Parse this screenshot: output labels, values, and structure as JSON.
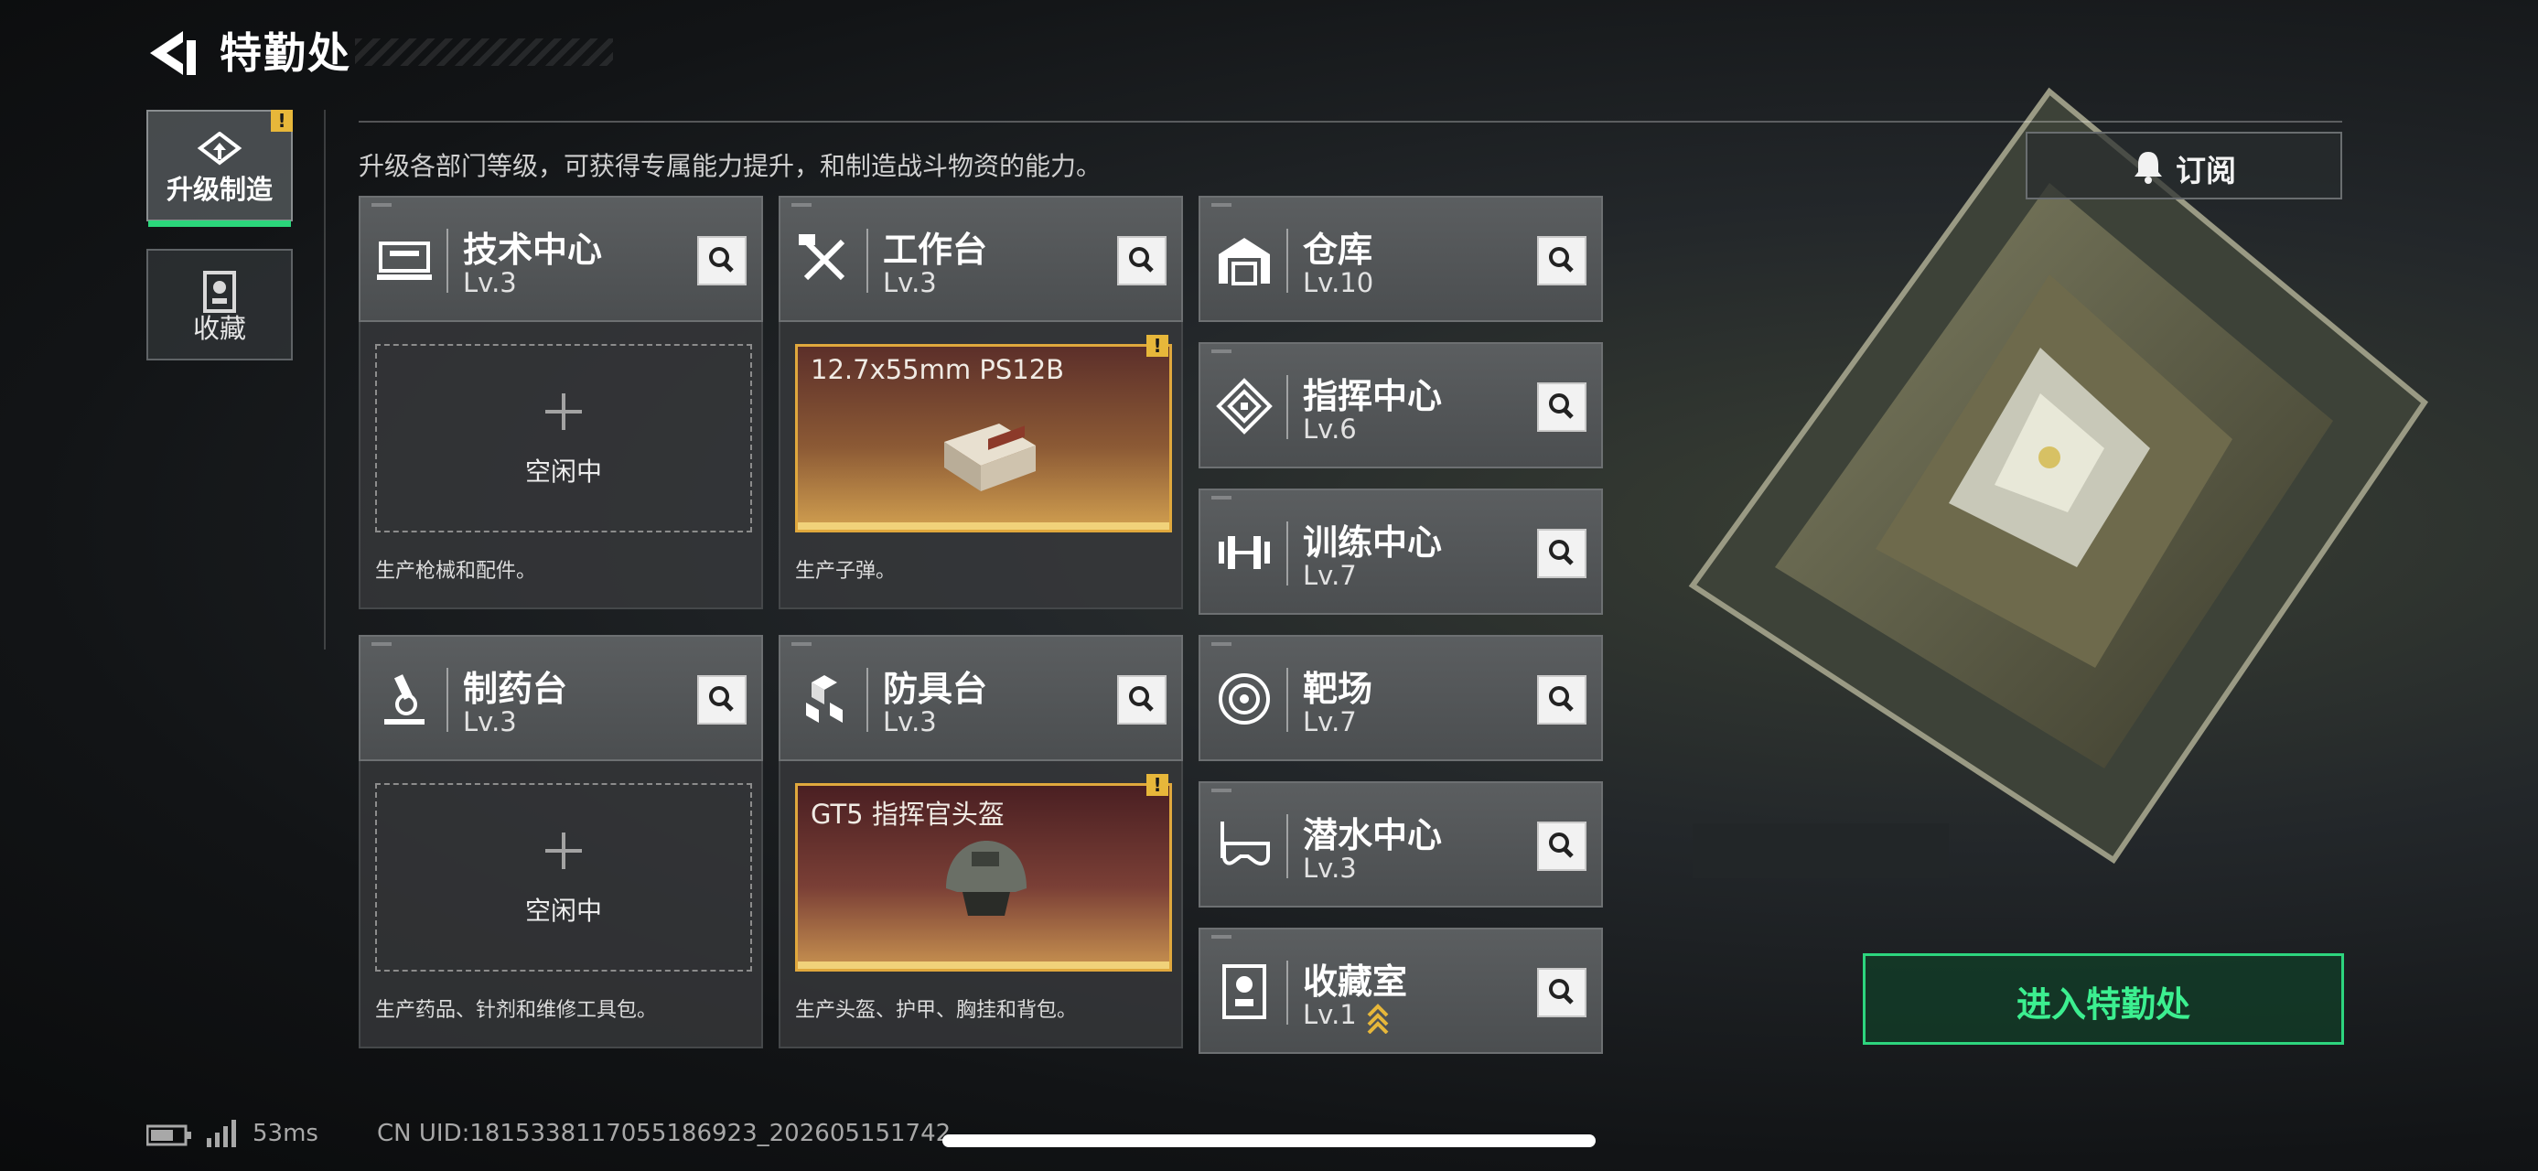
{
  "header": {
    "title": "特勤处"
  },
  "nav": {
    "tabs": [
      {
        "label": "升级制造",
        "active": true,
        "warning": "!"
      },
      {
        "label": "收藏",
        "active": false
      }
    ]
  },
  "subtitle": "升级各部门等级，可获得专属能力提升，和制造战斗物资的能力。",
  "subscribe": {
    "label": "订阅",
    "icon": "bell-icon"
  },
  "departments": {
    "tech_center": {
      "name": "技术中心",
      "level": "Lv.3",
      "icon": "tech-center-icon",
      "status": "空闲中",
      "desc": "生产枪械和配件。"
    },
    "workbench": {
      "name": "工作台",
      "level": "Lv.3",
      "icon": "hammer-wrench-icon",
      "product": "12.7x55mm PS12B",
      "warning": "!",
      "desc": "生产子弹。"
    },
    "pharmacy": {
      "name": "制药台",
      "level": "Lv.3",
      "icon": "microscope-icon",
      "status": "空闲中",
      "desc": "生产药品、针剂和维修工具包。"
    },
    "armor_bench": {
      "name": "防具台",
      "level": "Lv.3",
      "icon": "cubes-icon",
      "product": "GT5 指挥官头盔",
      "warning": "!",
      "desc": "生产头盔、护甲、胸挂和背包。"
    },
    "warehouse": {
      "name": "仓库",
      "level": "Lv.10",
      "icon": "warehouse-icon"
    },
    "command_center": {
      "name": "指挥中心",
      "level": "Lv.6",
      "icon": "chip-icon"
    },
    "training_center": {
      "name": "训练中心",
      "level": "Lv.7",
      "icon": "dumbbell-icon"
    },
    "shooting_range": {
      "name": "靶场",
      "level": "Lv.7",
      "icon": "target-icon"
    },
    "diving_center": {
      "name": "潜水中心",
      "level": "Lv.3",
      "icon": "diving-mask-icon"
    },
    "collection_room": {
      "name": "收藏室",
      "level": "Lv.1",
      "icon": "trophy-display-icon",
      "upgrade_indicator": "chevrons-up-icon"
    }
  },
  "enter_button": {
    "label": "进入特勤处"
  },
  "status_bar": {
    "ping": "53ms",
    "uid": "CN UID:1815338117055186923_202605151742"
  },
  "colors": {
    "accent_green": "#2bd67b",
    "warning_yellow": "#e7b73a",
    "production_gold": "#e0a83d"
  }
}
